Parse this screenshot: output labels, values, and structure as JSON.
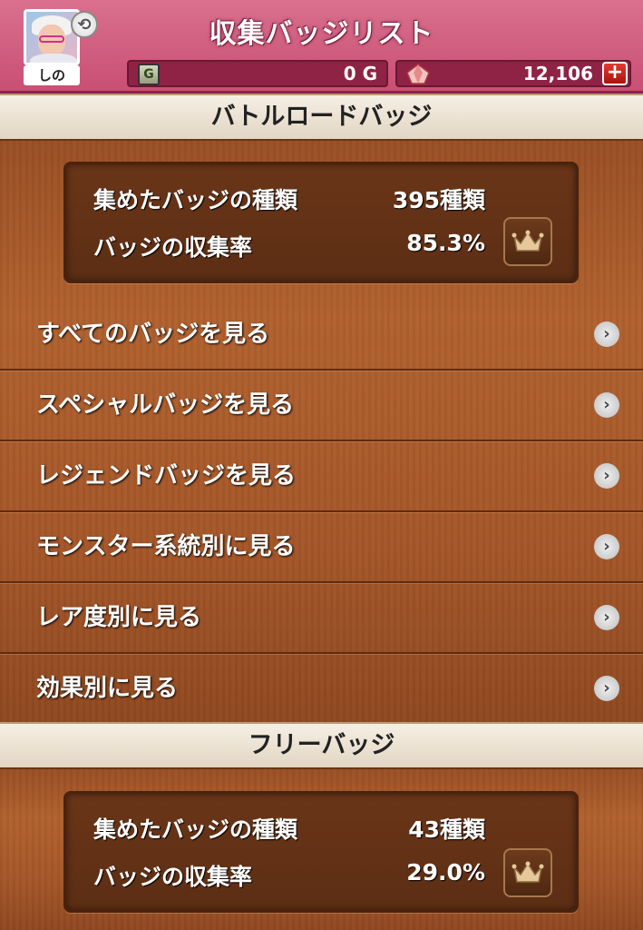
{
  "header": {
    "title": "収集バッジリスト",
    "player_name": "しの",
    "swap_icon": "refresh-icon",
    "gold_icon_label": "G",
    "gold_value": "0 G",
    "gem_value": "12,106",
    "plus_label": "+"
  },
  "battle_road": {
    "section_title": "バトルロードバッジ",
    "stats": {
      "types_label": "集めたバッジの種類",
      "types_value": "395種類",
      "rate_label": "バッジの収集率",
      "rate_value": "85.3%"
    },
    "menu": [
      {
        "label": "すべてのバッジを見る"
      },
      {
        "label": "スペシャルバッジを見る"
      },
      {
        "label": "レジェンドバッジを見る"
      },
      {
        "label": "モンスター系統別に見る"
      },
      {
        "label": "レア度別に見る"
      },
      {
        "label": "効果別に見る"
      }
    ]
  },
  "free": {
    "section_title": "フリーバッジ",
    "stats": {
      "types_label": "集めたバッジの種類",
      "types_value": "43種類",
      "rate_label": "バッジの収集率",
      "rate_value": "29.0%"
    }
  },
  "colors": {
    "header_pink": "#d9708e",
    "wood": "#a45628",
    "panel": "#5c2e14"
  }
}
